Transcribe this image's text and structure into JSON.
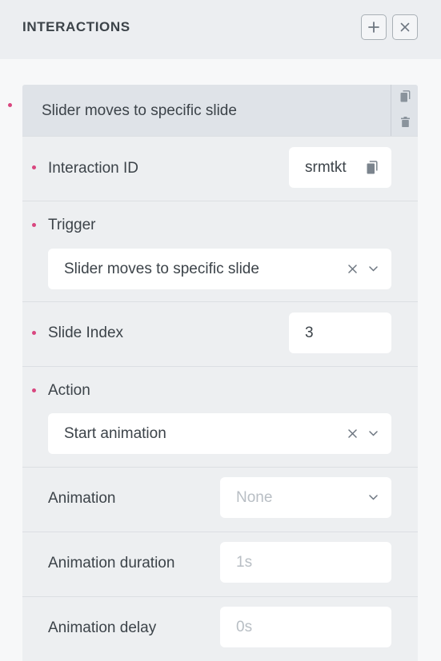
{
  "header": {
    "title": "INTERACTIONS",
    "add_icon": "plus-icon",
    "close_icon": "close-icon"
  },
  "interaction": {
    "title": "Slider moves to specific slide",
    "copy_icon": "copy-icon",
    "delete_icon": "trash-icon"
  },
  "fields": {
    "interaction_id": {
      "label": "Interaction ID",
      "value": "srmtkt"
    },
    "trigger": {
      "label": "Trigger",
      "value": "Slider moves to specific slide"
    },
    "slide_index": {
      "label": "Slide Index",
      "value": "3"
    },
    "action": {
      "label": "Action",
      "value": "Start animation"
    },
    "animation": {
      "label": "Animation",
      "placeholder": "None"
    },
    "animation_duration": {
      "label": "Animation duration",
      "placeholder": "1s"
    },
    "animation_delay": {
      "label": "Animation delay",
      "placeholder": "0s"
    }
  },
  "colors": {
    "required_dot": "#d9467f",
    "header_bg": "#eceef1",
    "card_bg": "#edeff1",
    "card_head_bg": "#dfe3e8"
  }
}
